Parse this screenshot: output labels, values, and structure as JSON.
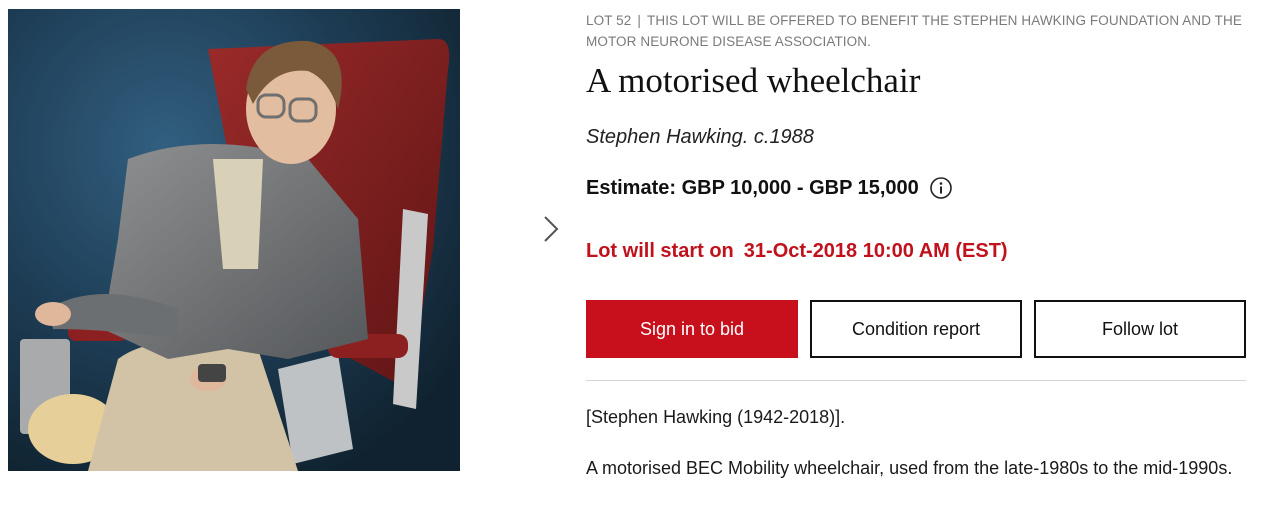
{
  "lot": {
    "number_label": "LOT 52",
    "separator": "|",
    "notice": "THIS LOT WILL BE OFFERED TO BENEFIT THE STEPHEN HAWKING FOUNDATION AND THE MOTOR NEURONE DISEASE ASSOCIATION."
  },
  "title": "A motorised wheelchair",
  "subtitle": "Stephen Hawking. c.1988",
  "estimate": "Estimate: GBP 10,000 - GBP 15,000",
  "start": {
    "label": "Lot will start on",
    "datetime": "31-Oct-2018 10:00 AM (EST)"
  },
  "buttons": {
    "sign_in": "Sign in to bid",
    "condition": "Condition report",
    "follow": "Follow lot"
  },
  "description": {
    "line1": "[Stephen Hawking (1942-2018)].",
    "line2": "A motorised BEC Mobility wheelchair, used from the late-1980s to the mid-1990s."
  },
  "icons": {
    "next": "chevron-right-icon",
    "info": "info-icon"
  },
  "colors": {
    "accent": "#c8101c",
    "start_text": "#c0121c",
    "muted": "#7a7a7a"
  }
}
